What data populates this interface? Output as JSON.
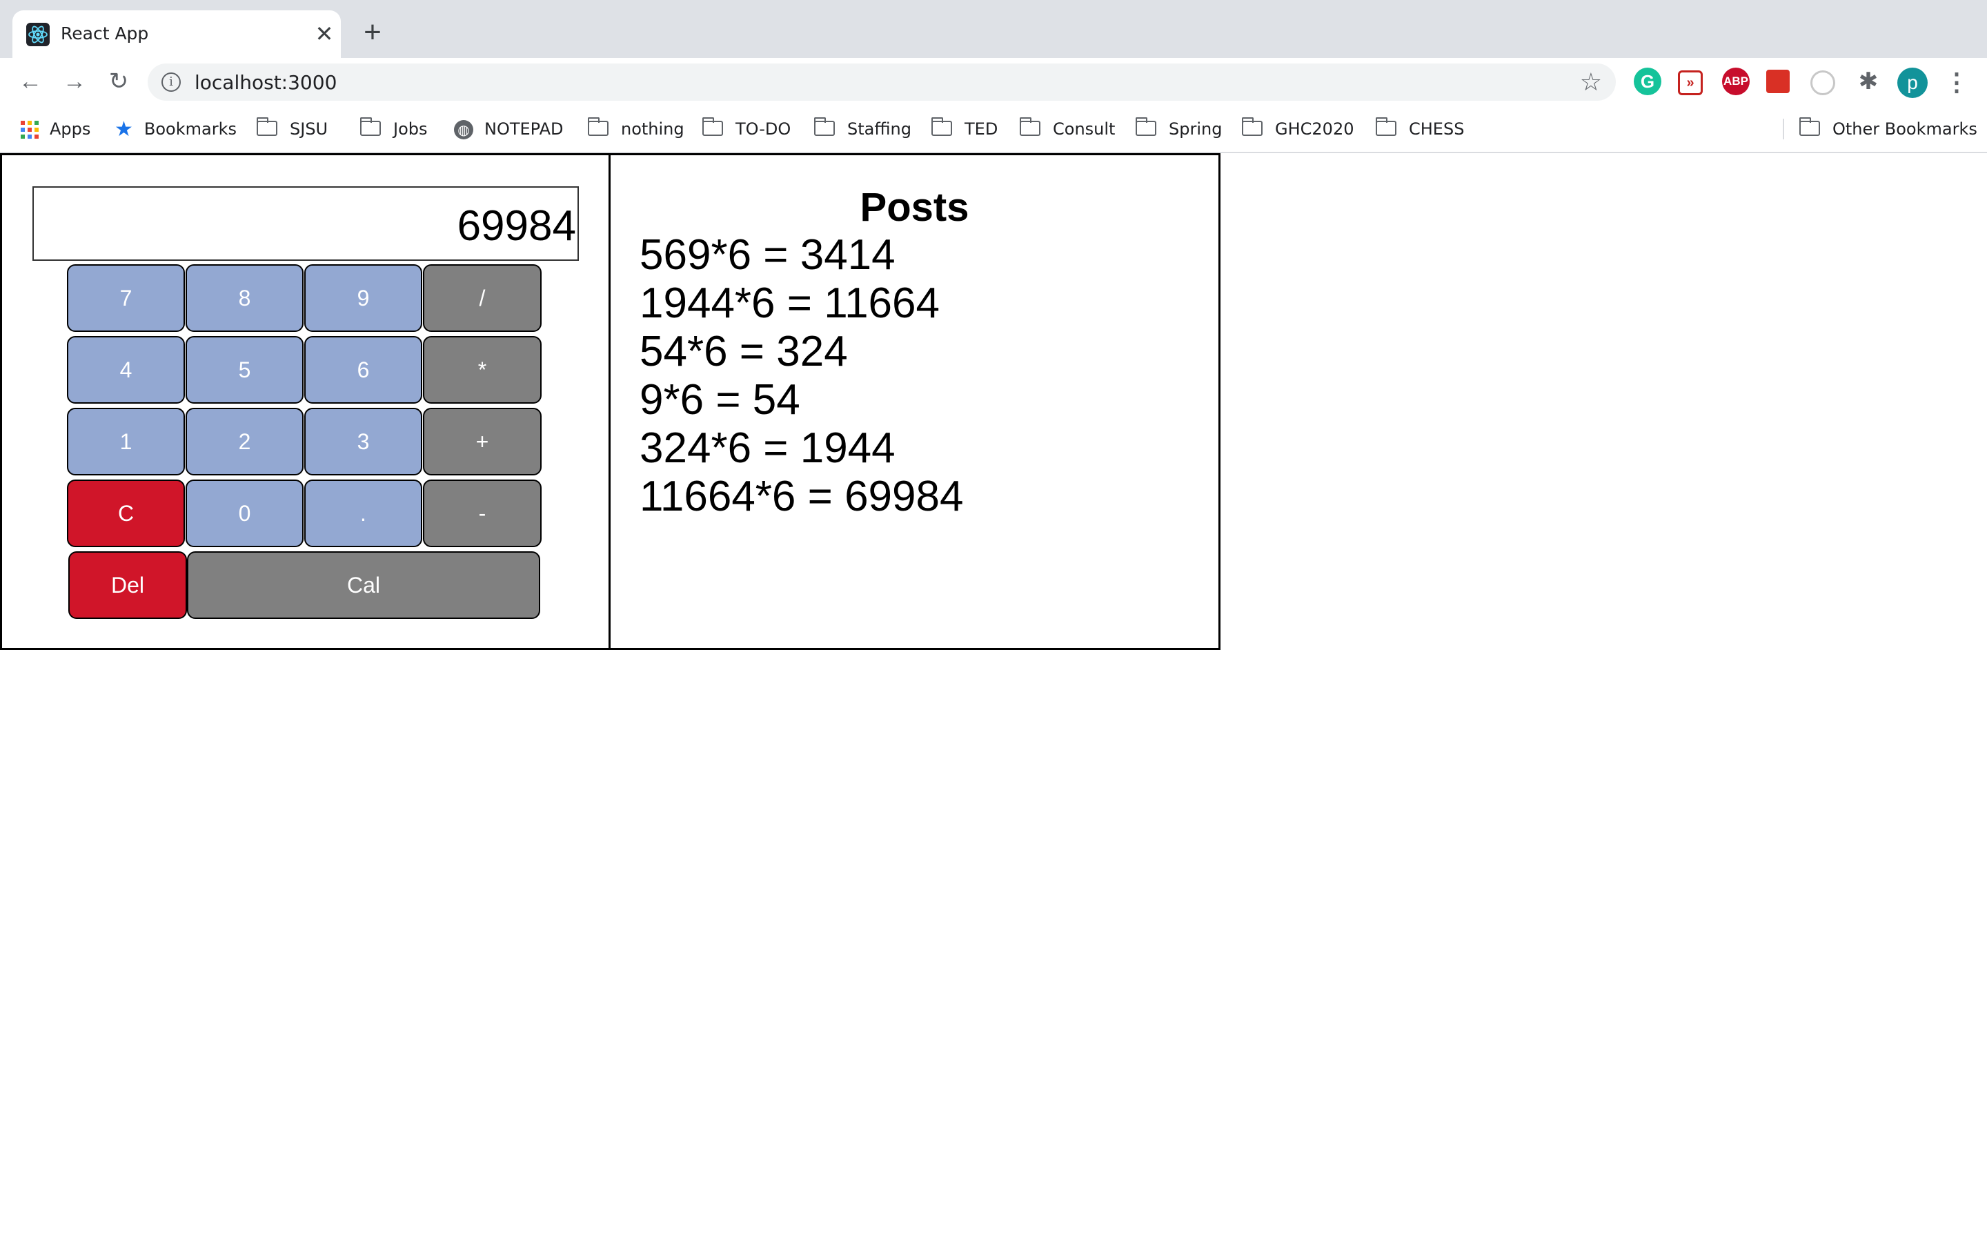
{
  "browser": {
    "tab": {
      "title": "React App",
      "favicon": "react-logo-icon",
      "close_glyph": "✕"
    },
    "new_tab_glyph": "+",
    "address": {
      "url": "localhost:3000"
    },
    "profile_initial": "p",
    "extension_labels": {
      "grammarly": "G",
      "abp": "ABP"
    },
    "bookmarks": [
      {
        "label": "Apps",
        "icon": "apps-grid-icon"
      },
      {
        "label": "Bookmarks",
        "icon": "star-icon"
      },
      {
        "label": "SJSU",
        "icon": "folder-icon"
      },
      {
        "label": "Jobs",
        "icon": "folder-icon"
      },
      {
        "label": "NOTEPAD",
        "icon": "globe-icon"
      },
      {
        "label": "nothing",
        "icon": "folder-icon"
      },
      {
        "label": "TO-DO",
        "icon": "folder-icon"
      },
      {
        "label": "Staffing",
        "icon": "folder-icon"
      },
      {
        "label": "TED",
        "icon": "folder-icon"
      },
      {
        "label": "Consult",
        "icon": "folder-icon"
      },
      {
        "label": "Spring",
        "icon": "folder-icon"
      },
      {
        "label": "GHC2020",
        "icon": "folder-icon"
      },
      {
        "label": "CHESS",
        "icon": "folder-icon"
      }
    ],
    "other_bookmarks": "Other Bookmarks"
  },
  "calculator": {
    "display": "69984",
    "keys": {
      "k7": "7",
      "k8": "8",
      "k9": "9",
      "div": "/",
      "k4": "4",
      "k5": "5",
      "k6": "6",
      "mul": "*",
      "k1": "1",
      "k2": "2",
      "k3": "3",
      "add": "+",
      "clear": "C",
      "k0": "0",
      "dot": ".",
      "sub": "-",
      "del": "Del",
      "cal": "Cal"
    },
    "colors": {
      "number_key": "#93a8d2",
      "operator_key": "#808080",
      "danger_key": "#d01529"
    }
  },
  "posts": {
    "title": "Posts",
    "items": [
      "569*6 = 3414",
      "1944*6 = 11664",
      "54*6 = 324",
      "9*6 = 54",
      "324*6 = 1944",
      "11664*6 = 69984"
    ]
  }
}
